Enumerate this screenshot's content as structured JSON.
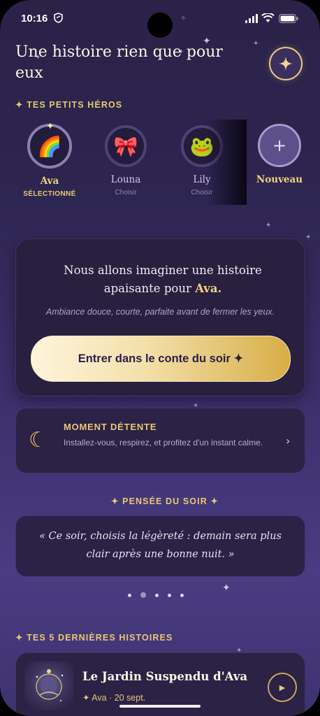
{
  "status_bar": {
    "time": "10:16"
  },
  "header": {
    "title": "Une histoire rien que pour eux"
  },
  "heroes_section": {
    "label": "TES PETITS HÉROS",
    "heroes": [
      {
        "name": "Ava",
        "status": "SÉLECTIONNÉ",
        "emoji": "🌈",
        "icon": "rainbow-icon",
        "selected": true
      },
      {
        "name": "Louna",
        "status": "Choisir",
        "emoji": "🎀",
        "icon": "ribbon-icon",
        "selected": false
      },
      {
        "name": "Lily",
        "status": "Choisir",
        "emoji": "🐸",
        "icon": "frog-icon",
        "selected": false
      }
    ],
    "new_label": "Nouveau",
    "new_symbol": "+"
  },
  "story_card": {
    "line1": "Nous allons imaginer une histoire",
    "line2_prefix": "apaisante pour",
    "line2_name": "Ava.",
    "subtitle": "Ambiance douce, courte, parfaite avant de fermer les yeux.",
    "cta_label": "Entrer dans le conte du soir ✦"
  },
  "relax_card": {
    "title": "MOMENT DÉTENTE",
    "text": "Installez-vous, respirez, et profitez d'un instant calme."
  },
  "thought": {
    "label": "PENSÉE DU SOIR",
    "quote": "« Ce soir, choisis la légèreté : demain sera plus clair après une bonne nuit. »",
    "page_count": 5,
    "active_index": 1
  },
  "recent": {
    "label": "TES 5 DERNIÈRES HISTOIRES",
    "items": [
      {
        "title": "Le Jardin Suspendu d'Ava",
        "meta": "✦ Ava · 20 sept."
      }
    ]
  },
  "colors": {
    "gold": "#e8c874",
    "background": "#2d2550",
    "card": "#2b2245"
  }
}
